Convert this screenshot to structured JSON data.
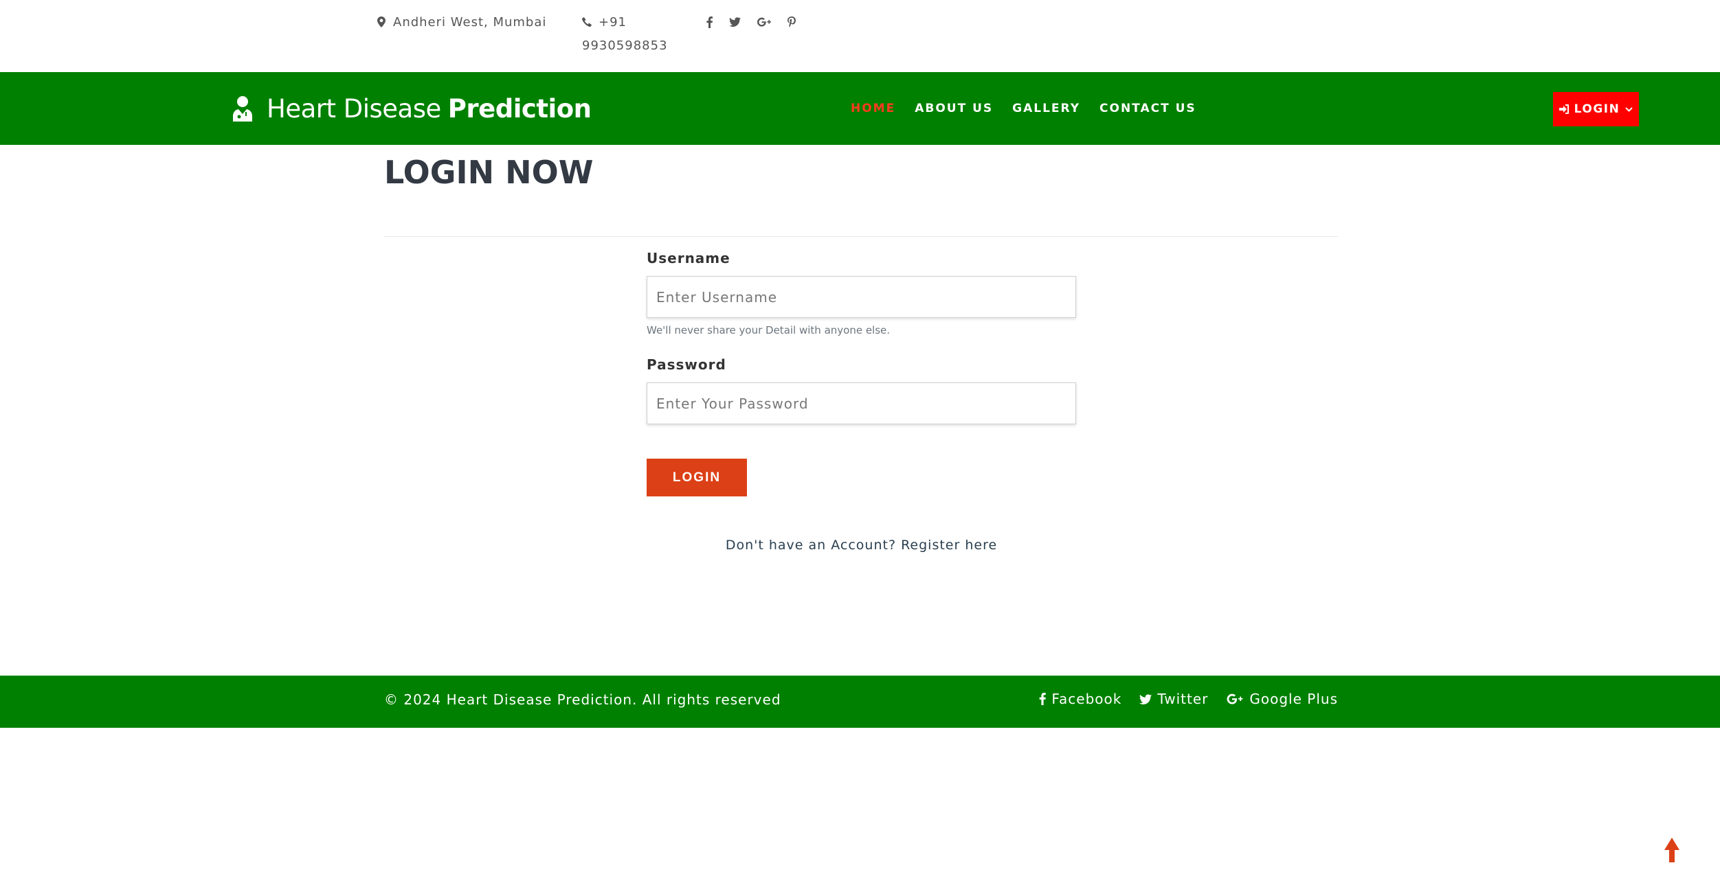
{
  "topbar": {
    "address": "Andheri West, Mumbai",
    "phone": "+91 9930598853",
    "social_icons": [
      "facebook-icon",
      "twitter-icon",
      "google-plus-icon",
      "pinterest-icon"
    ]
  },
  "nav": {
    "brand_light": "Heart Disease",
    "brand_bold": "Prediction",
    "links": [
      {
        "label": "HOME",
        "active": true
      },
      {
        "label": "ABOUT US"
      },
      {
        "label": "GALLERY"
      },
      {
        "label": "CONTACT US"
      }
    ],
    "login_label": "LOGIN"
  },
  "main": {
    "title": "LOGIN NOW",
    "username_label": "Username",
    "username_placeholder": "Enter Username",
    "username_help": "We'll never share your Detail with anyone else.",
    "password_label": "Password",
    "password_placeholder": "Enter Your Password",
    "submit_label": "LOGIN",
    "register_text": "Don't have an Account? Register here"
  },
  "footer": {
    "copyright": "© 2024 Heart Disease Prediction. All rights reserved",
    "social": [
      {
        "label": "Facebook",
        "icon": "facebook-icon"
      },
      {
        "label": "Twitter",
        "icon": "twitter-icon"
      },
      {
        "label": "Google Plus",
        "icon": "google-plus-icon"
      }
    ]
  },
  "colors": {
    "nav_green": "#008000",
    "active_link": "#ff3b1f",
    "login_red": "#ff0000",
    "button_orange": "#dc4016"
  }
}
